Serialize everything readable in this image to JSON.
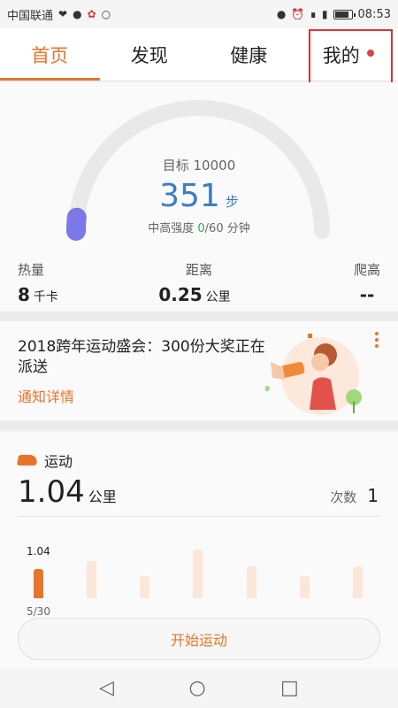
{
  "status_bar": {
    "carrier": "中国联通",
    "time": "08:53",
    "battery_level": 0.85,
    "icons": [
      "heart-wave-icon",
      "chat-bubble-icon",
      "huawei-icon",
      "wechat-icon",
      "location-icon",
      "alarm-icon",
      "wifi-icon",
      "signal-4g-icon",
      "battery-icon"
    ]
  },
  "tabs": [
    {
      "label": "首页",
      "active": true
    },
    {
      "label": "发现",
      "active": false
    },
    {
      "label": "健康",
      "active": false
    },
    {
      "label": "我的",
      "active": false,
      "badge": true
    }
  ],
  "steps_card": {
    "goal_label": "目标 10000",
    "steps": "351",
    "steps_unit": "步",
    "progress": 0.035,
    "intensity_prefix": "中高强度 ",
    "intensity_value": "0",
    "intensity_suffix": "/60 分钟",
    "stats": [
      {
        "label": "热量",
        "value": "8",
        "unit": "千卡"
      },
      {
        "label": "距离",
        "value": "0.25",
        "unit": "公里"
      },
      {
        "label": "爬高",
        "value": "--",
        "unit": ""
      }
    ],
    "colors": {
      "arc": "#e9e9e9",
      "progress": "#7b78e8",
      "steps": "#3b7ec8",
      "intensity": "#3aa55a"
    }
  },
  "promo": {
    "title": "2018跨年运动盛会：300份大奖正在派送",
    "link": "通知详情",
    "illustration": "woman-megaphone-illustration"
  },
  "sport": {
    "title": "运动",
    "distance": "1.04",
    "distance_unit": "公里",
    "count_label": "次数",
    "count": "1",
    "bar_value_label": "1.04",
    "bar_date_label": "5/30",
    "bars": [
      0.5,
      0.65,
      0.38,
      0.85,
      0.55,
      0.38,
      0.55
    ],
    "active_bar": 0,
    "start_label": "开始运动"
  },
  "accent_color": "#e8742b"
}
